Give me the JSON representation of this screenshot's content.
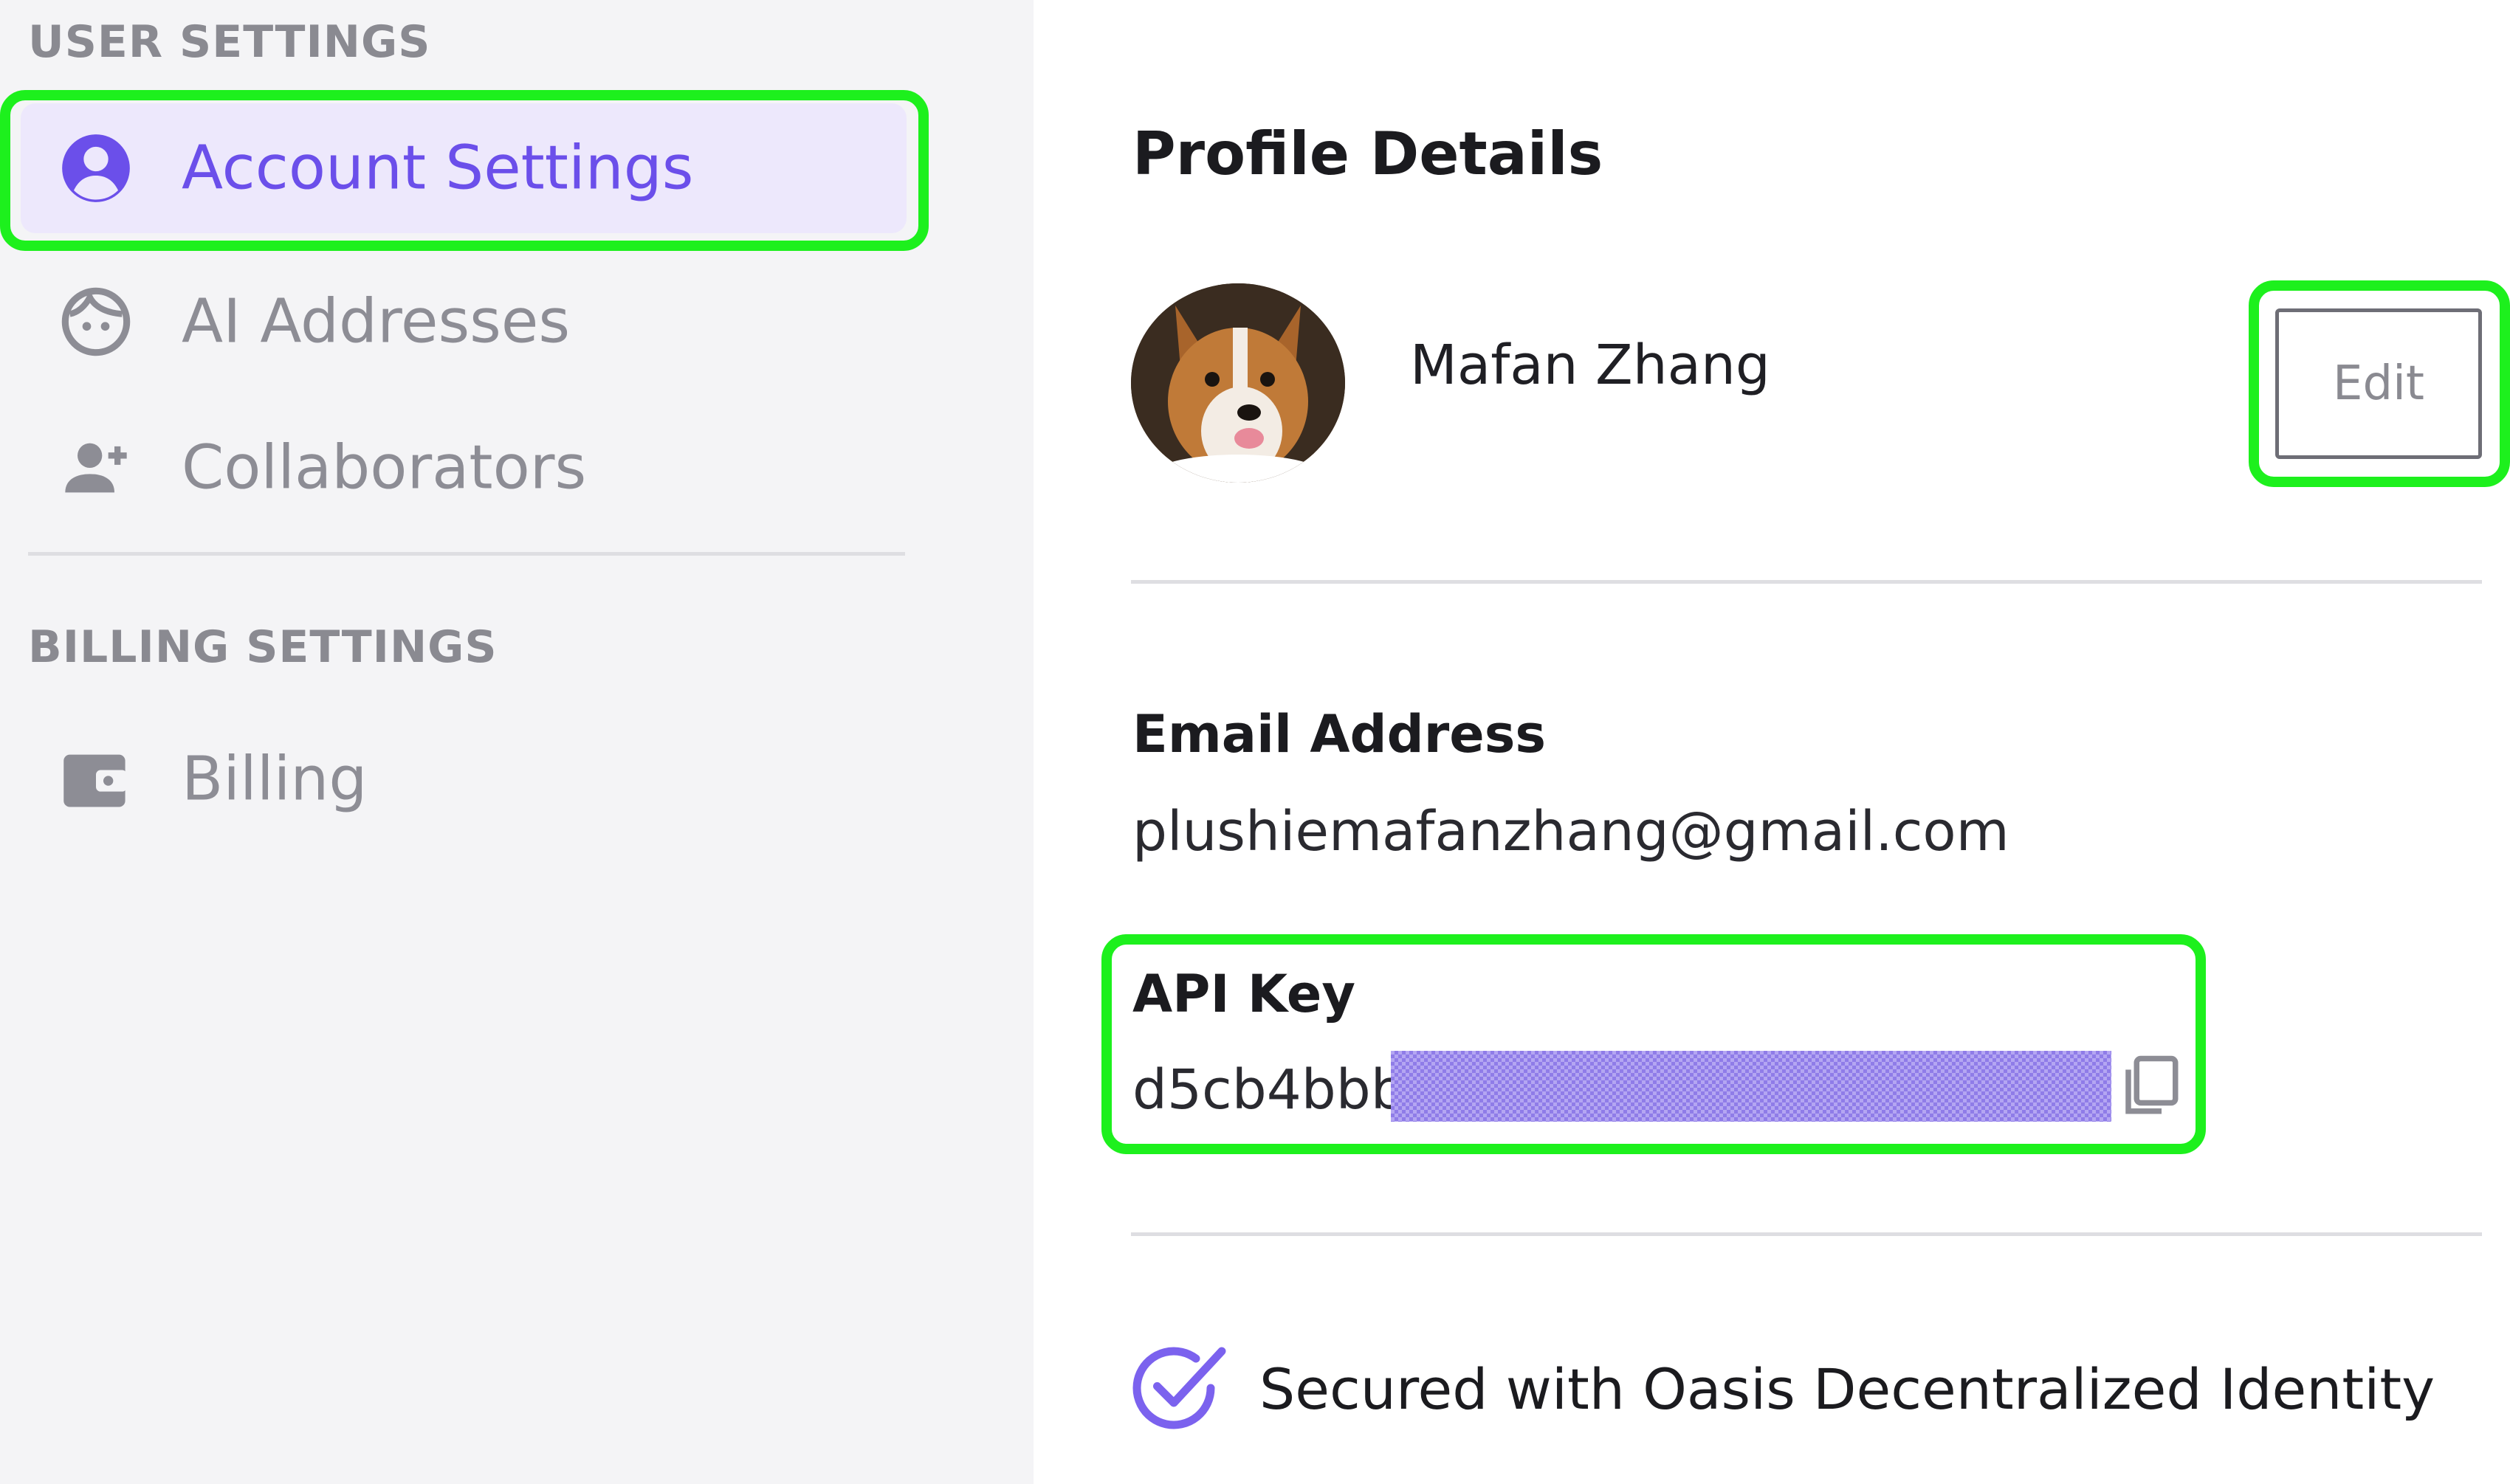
{
  "sidebar": {
    "user_section_label": "USER SETTINGS",
    "billing_section_label": "BILLING SETTINGS",
    "items": [
      {
        "label": "Account Settings",
        "icon": "account-circle-icon",
        "active": true
      },
      {
        "label": "AI Addresses",
        "icon": "ai-face-icon",
        "active": false
      },
      {
        "label": "Collaborators",
        "icon": "person-add-icon",
        "active": false
      }
    ],
    "billing_items": [
      {
        "label": "Billing",
        "icon": "wallet-icon",
        "active": false
      }
    ]
  },
  "profile": {
    "heading": "Profile Details",
    "name": "Mafan Zhang",
    "edit_label": "Edit",
    "avatar": "dog-avatar-image"
  },
  "email": {
    "heading": "Email Address",
    "value": "plushiemafanzhang@gmail.com"
  },
  "api_key": {
    "heading": "API Key",
    "visible_prefix": "d5cb4bbb",
    "copy_icon": "copy-icon"
  },
  "security": {
    "text": "Secured with Oasis Decentralized Identity",
    "icon": "check-circle-icon"
  },
  "colors": {
    "accent": "#6b4fea",
    "highlight": "#1df01d",
    "sidebar_bg": "#f4f4f6",
    "active_bg": "#ede8fc"
  }
}
